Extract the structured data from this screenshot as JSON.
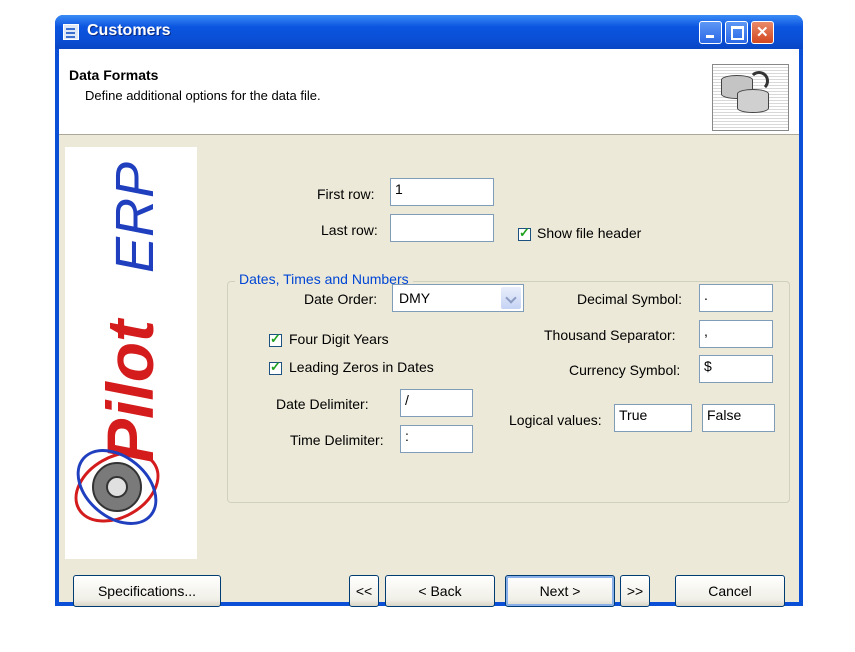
{
  "window": {
    "title": "Customers"
  },
  "header": {
    "title": "Data Formats",
    "subtitle": "Define additional options for the data file."
  },
  "logo": {
    "text_a": "Pilot",
    "text_b": "ERP"
  },
  "fields": {
    "first_row": {
      "label": "First row:",
      "value": "1"
    },
    "last_row": {
      "label": "Last row:",
      "value": ""
    },
    "show_file_header": {
      "label": "Show file header",
      "checked": true
    }
  },
  "group": {
    "title": "Dates, Times and Numbers",
    "date_order": {
      "label": "Date Order:",
      "value": "DMY"
    },
    "four_digit_years": {
      "label": "Four Digit Years",
      "checked": true
    },
    "leading_zeros": {
      "label": "Leading Zeros in Dates",
      "checked": true
    },
    "date_delimiter": {
      "label": "Date Delimiter:",
      "value": "/"
    },
    "time_delimiter": {
      "label": "Time Delimiter:",
      "value": ":"
    },
    "decimal_symbol": {
      "label": "Decimal Symbol:",
      "value": "."
    },
    "thousand_separator": {
      "label": "Thousand Separator:",
      "value": ","
    },
    "currency_symbol": {
      "label": "Currency Symbol:",
      "value": "$"
    },
    "logical_values": {
      "label": "Logical values:",
      "true_value": "True",
      "false_value": "False"
    }
  },
  "buttons": {
    "specifications": "Specifications...",
    "first": "<<",
    "back": "< Back",
    "next": "Next >",
    "last": ">>",
    "cancel": "Cancel"
  },
  "colors": {
    "titlebar": "#0a4fd6",
    "face": "#ece9d8",
    "group_title": "#0046d5",
    "logo_red": "#d41c1c",
    "logo_blue": "#1f3fbf"
  }
}
